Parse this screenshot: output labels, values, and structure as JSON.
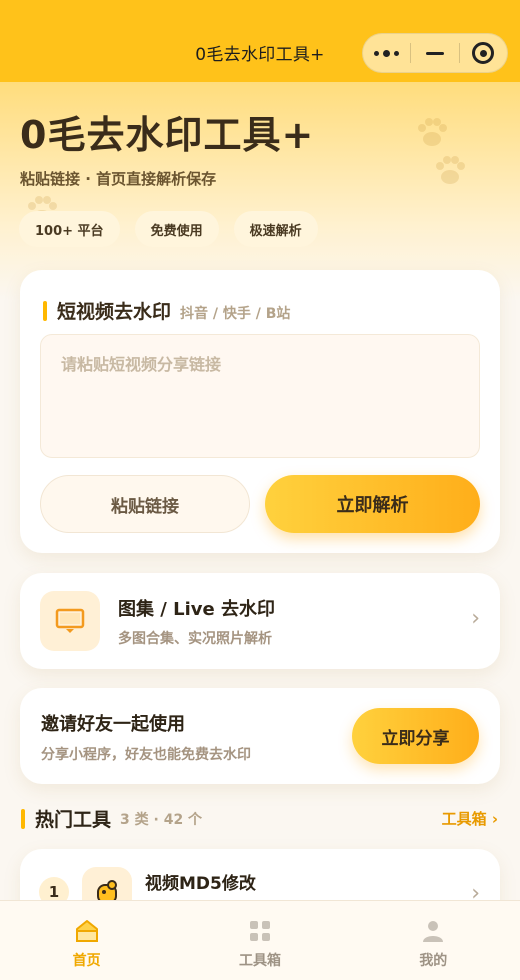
{
  "navbar": {
    "title": "0毛去水印工具+",
    "capsule": {
      "more_icon": "more-dots-icon",
      "minimize_icon": "minimize-icon",
      "close_icon": "close-target-icon"
    }
  },
  "hero": {
    "title": "0毛去水印工具+",
    "subtitle": "粘贴链接 · 首页直接解析保存",
    "chips": [
      "100+ 平台",
      "免费使用",
      "极速解析"
    ]
  },
  "video_section": {
    "title": "短视频去水印",
    "platforms": "抖音 / 快手 / B站",
    "input_placeholder": "请粘贴短视频分享链接",
    "paste_label": "粘贴链接",
    "parse_label": "立即解析"
  },
  "album_card": {
    "icon": "screen-icon",
    "title": "图集 / Live 去水印",
    "subtitle": "多图合集、实况照片解析",
    "chevron": "›"
  },
  "invite_card": {
    "title": "邀请好友一起使用",
    "subtitle": "分享小程序，好友也能免费去水印",
    "button_label": "立即分享"
  },
  "hot_tools": {
    "title": "热门工具",
    "meta": "3 类 · 42 个",
    "link_label": "工具箱 ›",
    "items": [
      {
        "rank": "1",
        "name": "视频MD5修改",
        "icon": "mascot-icon",
        "chevron": "›"
      }
    ]
  },
  "tabbar": {
    "items": [
      {
        "label": "首页",
        "icon": "home-icon",
        "active": true
      },
      {
        "label": "工具箱",
        "icon": "grid-icon",
        "active": false
      },
      {
        "label": "我的",
        "icon": "user-icon",
        "active": false
      }
    ]
  },
  "colors": {
    "brand": "#ffc21a",
    "accent": "#ffae1a",
    "link": "#e89a00",
    "text": "#3a2c1a"
  }
}
